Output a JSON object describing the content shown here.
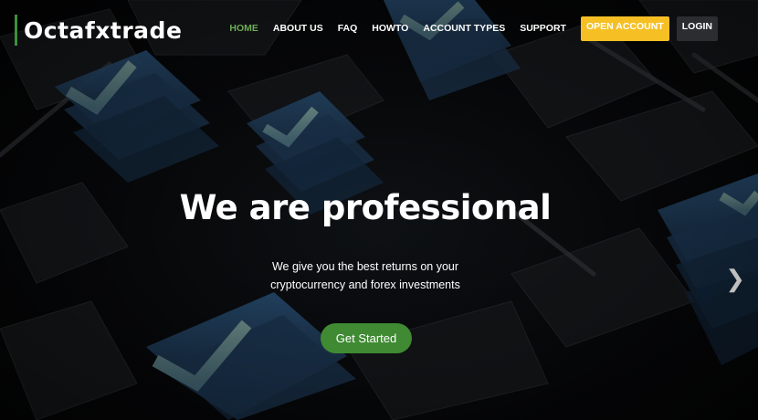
{
  "brand": {
    "name": "Octafxtrade"
  },
  "nav": {
    "items": [
      {
        "label": "HOME",
        "active": true
      },
      {
        "label": "ABOUT US"
      },
      {
        "label": "FAQ"
      },
      {
        "label": "HOWTO"
      },
      {
        "label": "ACCOUNT TYPES"
      },
      {
        "label": "SUPPORT"
      }
    ],
    "open_account_label": "OPEN ACCOUNT",
    "login_label": "LOGIN"
  },
  "hero": {
    "headline": "We are professional",
    "subtext_line1": "We give you the best returns on your",
    "subtext_line2": "cryptocurrency and forex investments",
    "cta_label": "Get Started",
    "next_icon": "chevron-right-icon"
  },
  "colors": {
    "brand_accent": "#3f8f39",
    "nav_active": "#6dab55",
    "open_account_bg": "#f6c024",
    "login_bg": "#2c2d30",
    "cta_bg": "#3f8a33"
  }
}
